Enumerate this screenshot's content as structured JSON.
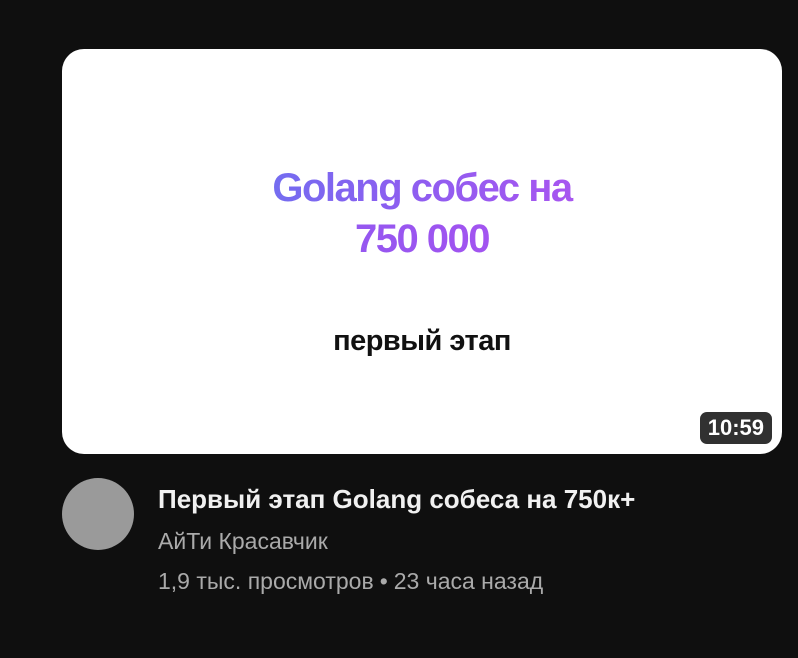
{
  "video": {
    "thumbnail": {
      "headline_line1": "Golang собес на",
      "headline_line2": "750 000",
      "subtitle": "первый этап",
      "gradient_colors": [
        "#4b86f0",
        "#8a5ff0",
        "#c84bf0"
      ]
    },
    "duration": "10:59",
    "title": "Первый этап Golang собеса на 750к+",
    "channel": "АйТи Красавчик",
    "views": "1,9 тыс. просмотров",
    "separator": "•",
    "age": "23 часа назад"
  },
  "colors": {
    "background": "#0f0f0f",
    "title_text": "#f1f1f1",
    "secondary_text": "#aaaaaa",
    "avatar_placeholder": "#9a9a9a",
    "badge_bg": "#141414"
  }
}
